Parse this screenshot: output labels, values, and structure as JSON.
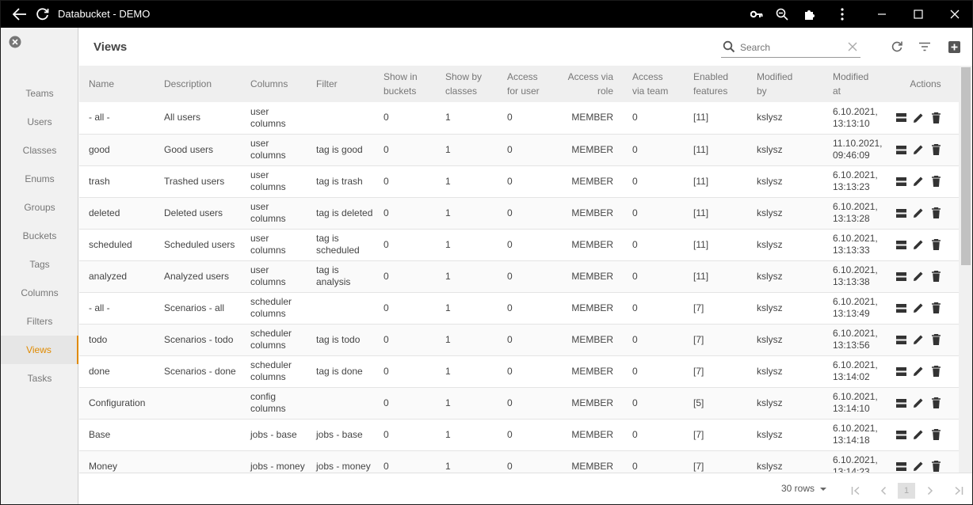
{
  "window": {
    "title": "Databucket - DEMO"
  },
  "sidebar": {
    "items": [
      {
        "label": "Teams",
        "active": false
      },
      {
        "label": "Users",
        "active": false
      },
      {
        "label": "Classes",
        "active": false
      },
      {
        "label": "Enums",
        "active": false
      },
      {
        "label": "Groups",
        "active": false
      },
      {
        "label": "Buckets",
        "active": false
      },
      {
        "label": "Tags",
        "active": false
      },
      {
        "label": "Columns",
        "active": false
      },
      {
        "label": "Filters",
        "active": false
      },
      {
        "label": "Views",
        "active": true
      },
      {
        "label": "Tasks",
        "active": false
      }
    ]
  },
  "header": {
    "title": "Views",
    "search_placeholder": "Search"
  },
  "table": {
    "columns": [
      {
        "line1": "Name",
        "line2": ""
      },
      {
        "line1": "Description",
        "line2": ""
      },
      {
        "line1": "Columns",
        "line2": ""
      },
      {
        "line1": "Filter",
        "line2": ""
      },
      {
        "line1": "Show in",
        "line2": "buckets"
      },
      {
        "line1": "Show by",
        "line2": "classes"
      },
      {
        "line1": "Access",
        "line2": "for user"
      },
      {
        "line1": "Access via",
        "line2": "role"
      },
      {
        "line1": "Access",
        "line2": "via team"
      },
      {
        "line1": "Enabled",
        "line2": "features"
      },
      {
        "line1": "Modified",
        "line2": "by"
      },
      {
        "line1": "Modified",
        "line2": "at"
      },
      {
        "line1": "Actions",
        "line2": ""
      }
    ],
    "rows": [
      {
        "name": "- all -",
        "description": "All users",
        "columns": "user columns",
        "filter": "",
        "buckets": "0",
        "classes": "1",
        "user": "0",
        "role": "MEMBER",
        "team": "0",
        "features": "[11]",
        "by": "kslysz",
        "at": "6.10.2021, 13:13:10"
      },
      {
        "name": "good",
        "description": "Good users",
        "columns": "user columns",
        "filter": "tag is good",
        "buckets": "0",
        "classes": "1",
        "user": "0",
        "role": "MEMBER",
        "team": "0",
        "features": "[11]",
        "by": "kslysz",
        "at": "11.10.2021, 09:46:09"
      },
      {
        "name": "trash",
        "description": "Trashed users",
        "columns": "user columns",
        "filter": "tag is trash",
        "buckets": "0",
        "classes": "1",
        "user": "0",
        "role": "MEMBER",
        "team": "0",
        "features": "[11]",
        "by": "kslysz",
        "at": "6.10.2021, 13:13:23"
      },
      {
        "name": "deleted",
        "description": "Deleted users",
        "columns": "user columns",
        "filter": "tag is deleted",
        "buckets": "0",
        "classes": "1",
        "user": "0",
        "role": "MEMBER",
        "team": "0",
        "features": "[11]",
        "by": "kslysz",
        "at": "6.10.2021, 13:13:28"
      },
      {
        "name": "scheduled",
        "description": "Scheduled users",
        "columns": "user columns",
        "filter": "tag is scheduled",
        "buckets": "0",
        "classes": "1",
        "user": "0",
        "role": "MEMBER",
        "team": "0",
        "features": "[11]",
        "by": "kslysz",
        "at": "6.10.2021, 13:13:33"
      },
      {
        "name": "analyzed",
        "description": "Analyzed users",
        "columns": "user columns",
        "filter": "tag is analysis",
        "buckets": "0",
        "classes": "1",
        "user": "0",
        "role": "MEMBER",
        "team": "0",
        "features": "[11]",
        "by": "kslysz",
        "at": "6.10.2021, 13:13:38"
      },
      {
        "name": "- all -",
        "description": "Scenarios - all",
        "columns": "scheduler columns",
        "filter": "",
        "buckets": "0",
        "classes": "1",
        "user": "0",
        "role": "MEMBER",
        "team": "0",
        "features": "[7]",
        "by": "kslysz",
        "at": "6.10.2021, 13:13:49"
      },
      {
        "name": "todo",
        "description": "Scenarios - todo",
        "columns": "scheduler columns",
        "filter": "tag is todo",
        "buckets": "0",
        "classes": "1",
        "user": "0",
        "role": "MEMBER",
        "team": "0",
        "features": "[7]",
        "by": "kslysz",
        "at": "6.10.2021, 13:13:56"
      },
      {
        "name": "done",
        "description": "Scenarios - done",
        "columns": "scheduler columns",
        "filter": "tag is done",
        "buckets": "0",
        "classes": "1",
        "user": "0",
        "role": "MEMBER",
        "team": "0",
        "features": "[7]",
        "by": "kslysz",
        "at": "6.10.2021, 13:14:02"
      },
      {
        "name": "Configuration",
        "description": "",
        "columns": "config columns",
        "filter": "",
        "buckets": "0",
        "classes": "1",
        "user": "0",
        "role": "MEMBER",
        "team": "0",
        "features": "[5]",
        "by": "kslysz",
        "at": "6.10.2021, 13:14:10"
      },
      {
        "name": "Base",
        "description": "",
        "columns": "jobs - base",
        "filter": "jobs - base",
        "buckets": "0",
        "classes": "1",
        "user": "0",
        "role": "MEMBER",
        "team": "0",
        "features": "[7]",
        "by": "kslysz",
        "at": "6.10.2021, 13:14:18"
      },
      {
        "name": "Money",
        "description": "",
        "columns": "jobs - money",
        "filter": "jobs - money",
        "buckets": "0",
        "classes": "1",
        "user": "0",
        "role": "MEMBER",
        "team": "0",
        "features": "[7]",
        "by": "kslysz",
        "at": "6.10.2021, 13:14:23"
      }
    ]
  },
  "footer": {
    "rows_per_page": "30 rows",
    "current_page": "1"
  },
  "colors": {
    "titlebar": "#000000",
    "accent": "#e08a00",
    "sidebar_bg": "#f1f1f1",
    "header_row": "#efefef"
  },
  "icons": {
    "back": "arrow-left-icon",
    "refresh": "refresh-icon",
    "key": "key-icon",
    "zoom": "zoom-out-icon",
    "extension": "puzzle-icon",
    "menu": "more-vert-icon",
    "minimize": "minimize-icon",
    "maximize": "maximize-icon",
    "close": "close-icon",
    "search": "search-icon",
    "filter": "filter-icon",
    "add": "add-box-icon",
    "row_view": "view-rows-icon",
    "row_edit": "edit-icon",
    "row_delete": "delete-icon"
  }
}
